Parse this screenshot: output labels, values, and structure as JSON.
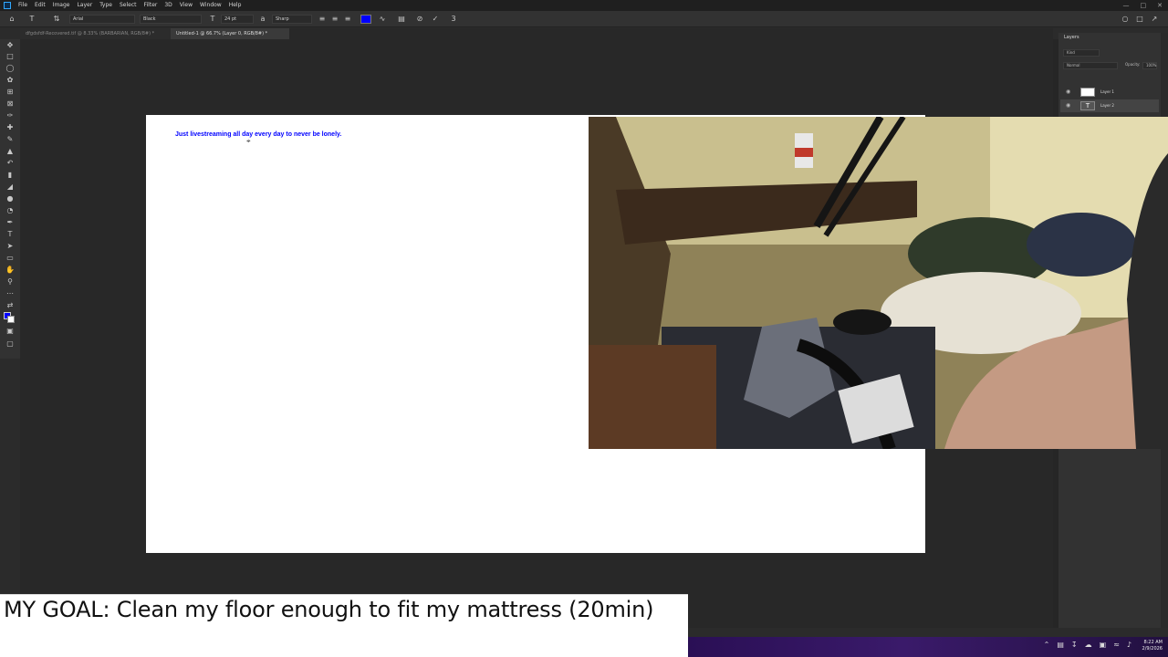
{
  "menubar": {
    "items": [
      "File",
      "Edit",
      "Image",
      "Layer",
      "Type",
      "Select",
      "Filter",
      "3D",
      "View",
      "Window",
      "Help"
    ]
  },
  "options": {
    "font_family": "Arial",
    "font_style": "Black",
    "font_size": "24 pt",
    "antialias": "Sharp",
    "text_color": "#0000ff"
  },
  "tabs": [
    {
      "label": "dfgdsfdf-Recovered.tif @ 8.33% (BARBARIAN, RGB/8#) *"
    },
    {
      "label": "Untitled-1 @ 66.7% (Layer 0, RGB/8#) *"
    }
  ],
  "canvas": {
    "text": "Just livestreaming all day every day to never be lonely."
  },
  "layers_panel": {
    "title": "Layers",
    "search_placeholder": "Kind",
    "blend_mode": "Normal",
    "opacity_label": "Opacity:",
    "opacity_value": "100%",
    "layers": [
      {
        "name": "Layer 1"
      },
      {
        "name": "Layer 2"
      }
    ]
  },
  "overlay": {
    "goal": "MY GOAL: Clean my floor enough to fit my mattress (20min)"
  },
  "taskbar": {
    "time": "8:22 AM",
    "date": "2/9/2026"
  },
  "colors": {
    "accent": "#0000ff",
    "app_bg": "#282828",
    "taskbar": "#3a1a6a"
  }
}
